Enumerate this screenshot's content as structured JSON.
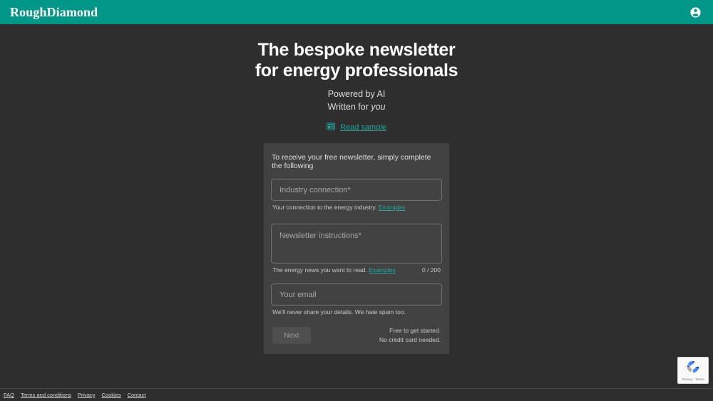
{
  "header": {
    "brand": "RoughDiamond",
    "account_icon": "account-circle-icon"
  },
  "hero": {
    "title_line1": "The bespoke newsletter",
    "title_line2": "for energy professionals",
    "tagline_line1": "Powered by AI",
    "tagline_line2_prefix": "Written for ",
    "tagline_line2_emphasis": "you",
    "sample_icon": "newspaper-icon",
    "sample_link": "Read sample"
  },
  "form": {
    "intro": "To receive your free newsletter, simply complete the following",
    "industry": {
      "placeholder": "Industry connection*",
      "value": "",
      "help": "Your connection to the energy industry.",
      "examples_link": "Examples"
    },
    "instructions": {
      "placeholder": "Newsletter instructions*",
      "value": "",
      "help": "The energy news you want to read.",
      "examples_link": "Examples",
      "counter": "0 / 200"
    },
    "email": {
      "placeholder": "Your email",
      "value": "",
      "help_prefix": "We'll ",
      "help_emphasis": "never",
      "help_suffix": " share your details. We hate spam too."
    },
    "next_label": "Next",
    "assurance_line1": "Free to get started.",
    "assurance_line2": "No credit card needed."
  },
  "footer": {
    "links": [
      {
        "label": "FAQ"
      },
      {
        "label": "Terms and conditions"
      },
      {
        "label": "Privacy"
      },
      {
        "label": "Cookies"
      },
      {
        "label": "Contact"
      }
    ]
  },
  "recaptcha": {
    "icon": "recaptcha-icon",
    "legal": "Privacy - Terms"
  },
  "colors": {
    "brand_teal": "#009688",
    "link_teal": "#26a69a",
    "page_bg": "#2e2e2e",
    "card_bg": "#424242"
  }
}
